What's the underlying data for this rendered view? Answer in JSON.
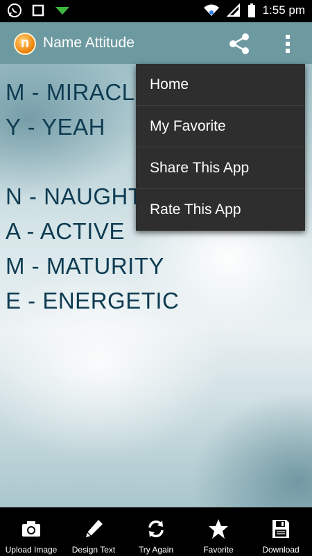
{
  "status_bar": {
    "time": "1:55 pm",
    "icons": [
      "whatsapp-icon",
      "square-notification-icon",
      "download-arrow-icon",
      "wifi-icon",
      "signal-icon",
      "battery-icon"
    ]
  },
  "app_bar": {
    "logo_letter": "n",
    "title": "Name Attitude",
    "icons": [
      "share-icon",
      "more-vert-icon"
    ]
  },
  "content": {
    "lines": [
      "M - MIRACLE",
      "Y - YEAH",
      "",
      "N - NAUGHTY",
      "A - ACTIVE",
      "M - MATURITY",
      "E - ENERGETIC"
    ]
  },
  "menu": {
    "items": [
      "Home",
      "My Favorite",
      "Share This App",
      "Rate This App"
    ]
  },
  "bottom_bar": {
    "buttons": [
      {
        "label": "Upload Image",
        "icon": "camera-icon"
      },
      {
        "label": "Design Text",
        "icon": "pencil-icon"
      },
      {
        "label": "Try Again",
        "icon": "refresh-icon"
      },
      {
        "label": "Favorite",
        "icon": "star-icon"
      },
      {
        "label": "Download",
        "icon": "save-icon"
      }
    ]
  },
  "colors": {
    "app_bar": "#6d9aa0",
    "text": "#0e3c52",
    "menu_bg": "#2e2e2e"
  }
}
